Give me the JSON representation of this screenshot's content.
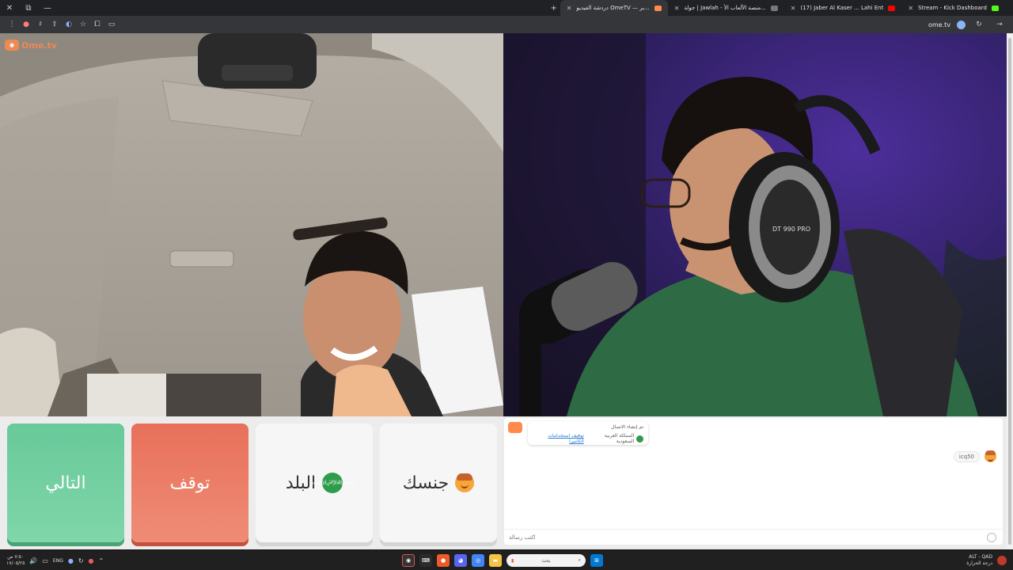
{
  "browser": {
    "window_controls": [
      "✕",
      "⧉",
      "—"
    ],
    "tabs": [
      {
        "label": "Stream - Kick Dashboard",
        "color": "#53fc18",
        "active": false
      },
      {
        "label": "(17) Jaber Al Kaser ... Lahi Ent",
        "color": "#ff0000",
        "active": false
      },
      {
        "label": "جولة | Jawlah - منصة الألعاب الأ...",
        "color": "#555555",
        "active": false
      },
      {
        "label": "دردشة الفيديو OmeTV — بر...",
        "color": "#ff8a4c",
        "active": true
      }
    ],
    "address": "ome.tv"
  },
  "video": {
    "logo_text": "Ome.tv",
    "left_scene": "stranger-webcam",
    "right_scene": "streamer-webcam"
  },
  "controls": {
    "next_label": "التالي",
    "stop_label": "توقف",
    "country_label": "البلد",
    "country_flag": "saudi-arabia-flag",
    "gender_label": "جنسك",
    "gender_icon": "male-face-icon"
  },
  "chat": {
    "system_line1": "تم إنشاء الاتصال",
    "system_country": "المملكة العربية السعودية",
    "system_link": "توقيف استخدامات الكاميرا",
    "user_message": "icq50",
    "input_placeholder": "اكتب رسالة"
  },
  "taskbar": {
    "search_placeholder": "بحث",
    "language": "ENG",
    "clock_time": "٧:٥٠ ص",
    "clock_date": "١٧/٠٥/٢٥",
    "tray_label_right": "ALT - QAD",
    "tray_sublabel_right": "درجة الحرارة"
  }
}
